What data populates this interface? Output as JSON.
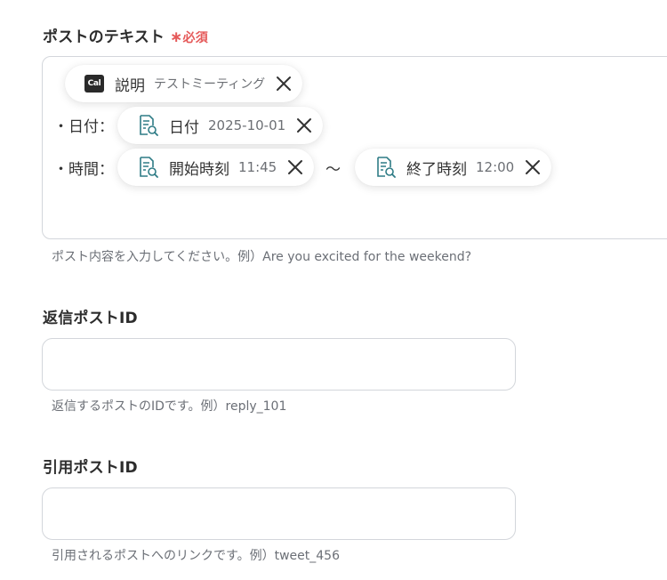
{
  "post_text": {
    "label": "ポストのテキスト",
    "required_mark": "∗",
    "required_text": "必須",
    "lines": {
      "date_prefix": "・日付：",
      "time_prefix": "・時間：",
      "tilde": "〜"
    },
    "chips": {
      "description": {
        "label": "説明",
        "value": "テストミーティング",
        "icon": "cal-logo"
      },
      "date": {
        "label": "日付",
        "value": "2025-10-01",
        "icon": "document-search-icon"
      },
      "start_time": {
        "label": "開始時刻",
        "value": "11:45",
        "icon": "document-search-icon"
      },
      "end_time": {
        "label": "終了時刻",
        "value": "12:00",
        "icon": "document-search-icon"
      }
    },
    "logo_text": "Cal",
    "helper": "ポスト内容を入力してください。例）Are you excited for the weekend?"
  },
  "reply_post_id": {
    "label": "返信ポストID",
    "value": "",
    "helper": "返信するポストのIDです。例）reply_101"
  },
  "quote_post_id": {
    "label": "引用ポストID",
    "value": "",
    "helper": "引用されるポストへのリンクです。例）tweet_456"
  },
  "colors": {
    "required": "#e55a5a",
    "icon_teal": "#2f7c86"
  }
}
